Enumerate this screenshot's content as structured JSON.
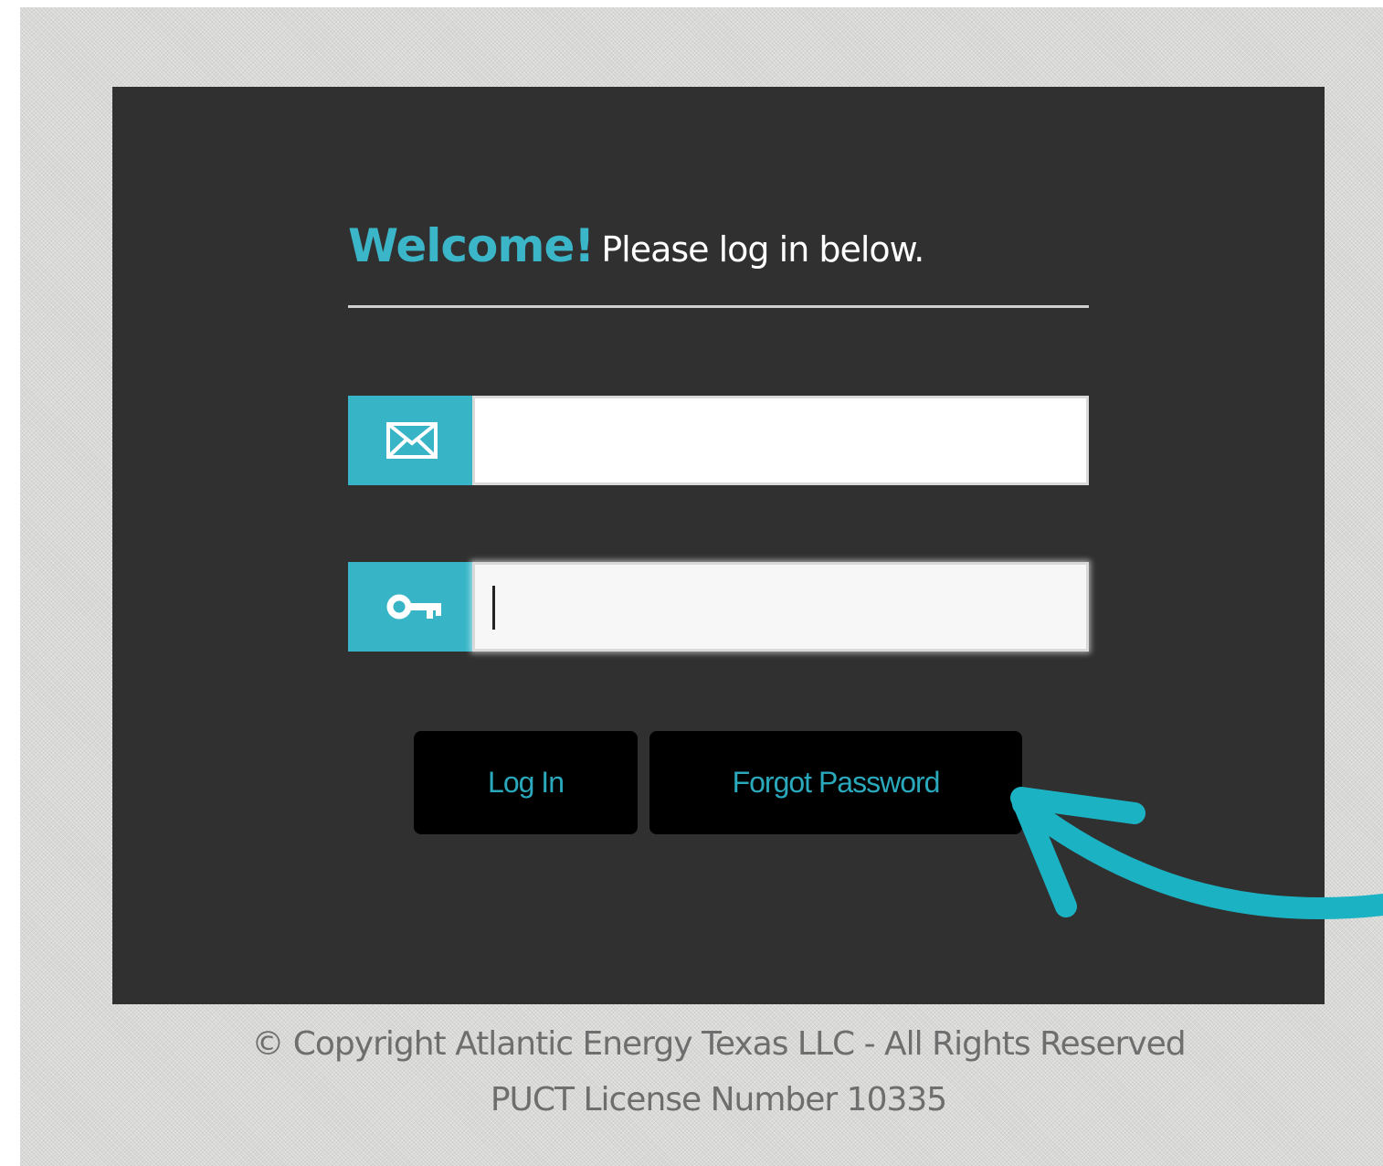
{
  "login": {
    "welcome_accent": "Welcome!",
    "welcome_rest": "Please log in below.",
    "email_icon": "envelope-icon",
    "password_icon": "key-icon",
    "email_value": "",
    "password_value": "",
    "login_label": "Log In",
    "forgot_label": "Forgot Password"
  },
  "footer": {
    "copyright": "© Copyright Atlantic Energy Texas LLC - All Rights Reserved",
    "license": "PUCT License Number 10335"
  },
  "annotation": {
    "arrow": "curved-arrow-pointing-to-forgot-password"
  },
  "colors": {
    "accent": "#37b5c7",
    "panel": "#303030",
    "button": "#000000",
    "button_text": "#2aa9bd",
    "arrow": "#1bb3c4"
  }
}
